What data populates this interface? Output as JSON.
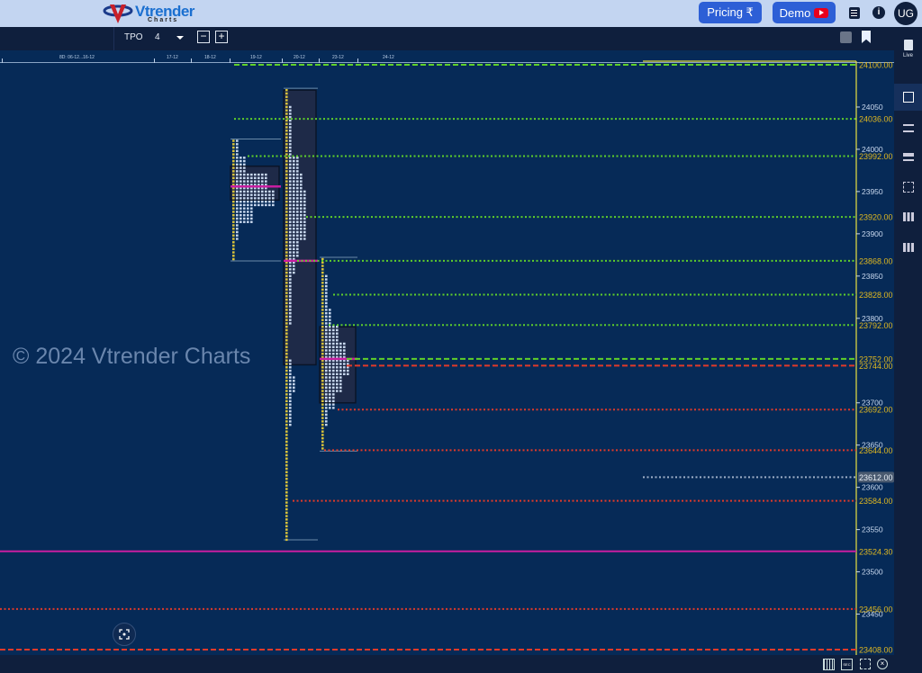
{
  "header": {
    "logo_text": "Vtrender",
    "logo_sub": "Charts",
    "pricing_label": "Pricing ₹",
    "demo_label": "Demo",
    "avatar": "UG",
    "icons": [
      "list-icon",
      "info-icon"
    ]
  },
  "toolbar": {
    "chart_type": "TPO",
    "tick": "4",
    "icons": [
      "minus-icon",
      "plus-icon",
      "save-icon",
      "bookmark-add-icon"
    ]
  },
  "date_axis": [
    "8D: 06-12...16-12",
    "17-12",
    "18-12",
    "19-12",
    "20-12",
    "23-12",
    "24-12"
  ],
  "sidebar": {
    "live_label": "Live",
    "icons": [
      "document-icon",
      "square-icon",
      "split-list-icon",
      "list-icon",
      "grid-icon",
      "columns-icon",
      "grid-small-icon"
    ]
  },
  "watermark": "© 2024 Vtrender Charts",
  "price_axis": {
    "max": 24100,
    "min": 23408,
    "ticks": [
      "24050",
      "24000",
      "23950",
      "23900",
      "23850",
      "23800",
      "23700",
      "23650",
      "23600",
      "23550",
      "23500",
      "23450"
    ]
  },
  "levels": [
    {
      "label": "24100.00",
      "price": 24100,
      "color": "#5fd02a",
      "style": "dashed"
    },
    {
      "label": "24036.00",
      "price": 24036,
      "color": "#5fd02a",
      "style": "dotted"
    },
    {
      "label": "23992.00",
      "price": 23992,
      "color": "#5fd02a",
      "style": "dotted"
    },
    {
      "label": "23920.00",
      "price": 23920,
      "color": "#5fd02a",
      "style": "dotted"
    },
    {
      "label": "23868.00",
      "price": 23868,
      "color": "#5fd02a",
      "style": "dotted"
    },
    {
      "label": "23828.00",
      "price": 23828,
      "color": "#5fd02a",
      "style": "dotted"
    },
    {
      "label": "23792.00",
      "price": 23792,
      "color": "#5fd02a",
      "style": "dotted"
    },
    {
      "label": "23752.00",
      "price": 23752,
      "color": "#5fd02a",
      "style": "dashed"
    },
    {
      "label": "23744.00",
      "price": 23744,
      "color": "#e03a2a",
      "style": "dashed"
    },
    {
      "label": "23692.00",
      "price": 23692,
      "color": "#e03a2a",
      "style": "dotted"
    },
    {
      "label": "23644.00",
      "price": 23644,
      "color": "#e03a2a",
      "style": "dotted"
    },
    {
      "label": "23612.00",
      "price": 23612,
      "color": "#9fb0c8",
      "style": "dotted",
      "current": true
    },
    {
      "label": "23584.00",
      "price": 23584,
      "color": "#e03a2a",
      "style": "dotted"
    },
    {
      "label": "23524.30",
      "price": 23524.3,
      "color": "#c81ea0",
      "style": "solid"
    },
    {
      "label": "23456.00",
      "price": 23456,
      "color": "#e03a2a",
      "style": "dotted"
    },
    {
      "label": "23408.00",
      "price": 23408,
      "color": "#e03a2a",
      "style": "dashed"
    }
  ],
  "sessions": [
    {
      "date": "19-12",
      "high": 24010,
      "low": 23870,
      "va_high": 23980,
      "va_low": 23940,
      "poc": 23956,
      "counts": [
        2,
        4,
        10,
        12,
        6,
        2,
        1,
        1
      ]
    },
    {
      "date": "20-12",
      "high": 24070,
      "low": 23540,
      "va_high": 24070,
      "va_low": 23745,
      "poc": 23868,
      "counts": [
        1,
        2,
        2,
        2,
        4,
        5,
        6,
        6,
        6,
        4,
        3,
        2,
        2,
        2,
        1,
        1,
        2,
        3,
        2,
        2,
        1,
        1,
        1,
        1,
        1,
        1,
        1
      ]
    },
    {
      "date": "23-12",
      "high": 23870,
      "low": 23645,
      "va_high": 23790,
      "va_low": 23700,
      "poc": 23752,
      "counts": [
        1,
        2,
        2,
        3,
        5,
        7,
        8,
        6,
        4,
        2,
        1,
        1
      ]
    }
  ],
  "bottom_bar": {
    "icons": [
      "grid-icon",
      "sec-icon",
      "focus-icon",
      "close-circle-icon"
    ],
    "sec_label": "SEC"
  },
  "colors": {
    "background": "#062a57",
    "header": "#c3d5f1",
    "toolbar": "#0f1f3d",
    "accent": "#2d5fd6",
    "axis_line": "#e8e040",
    "tpo_yellow": "#d8c23a",
    "tpo_white": "#c8d8ee"
  }
}
